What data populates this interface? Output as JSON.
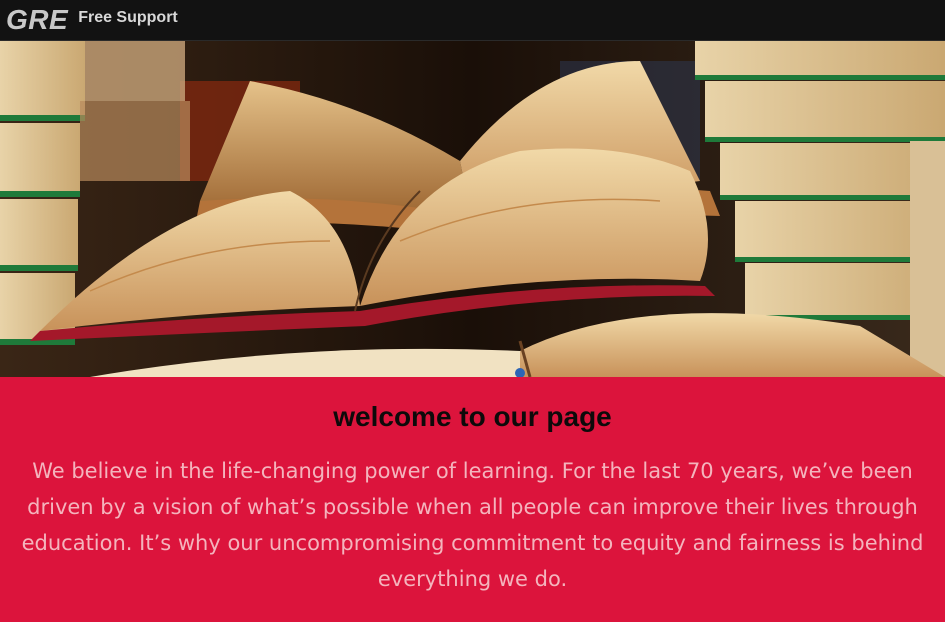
{
  "navbar": {
    "brand": "GRE",
    "link": "Free Support"
  },
  "hero": {
    "image": "stack-of-open-books"
  },
  "content": {
    "heading": "welcome to our page",
    "paragraph": "We believe in the life-changing power of learning. For the last 70 years, we’ve been driven by a vision of what’s possible when all people can improve their lives through education. It’s why our uncompromising commitment to equity and fairness is behind everything we do."
  },
  "colors": {
    "navbar_bg": "#121212",
    "content_bg": "#dc143c",
    "heading": "#0d0a0a",
    "paragraph": "#f4b4bd"
  }
}
